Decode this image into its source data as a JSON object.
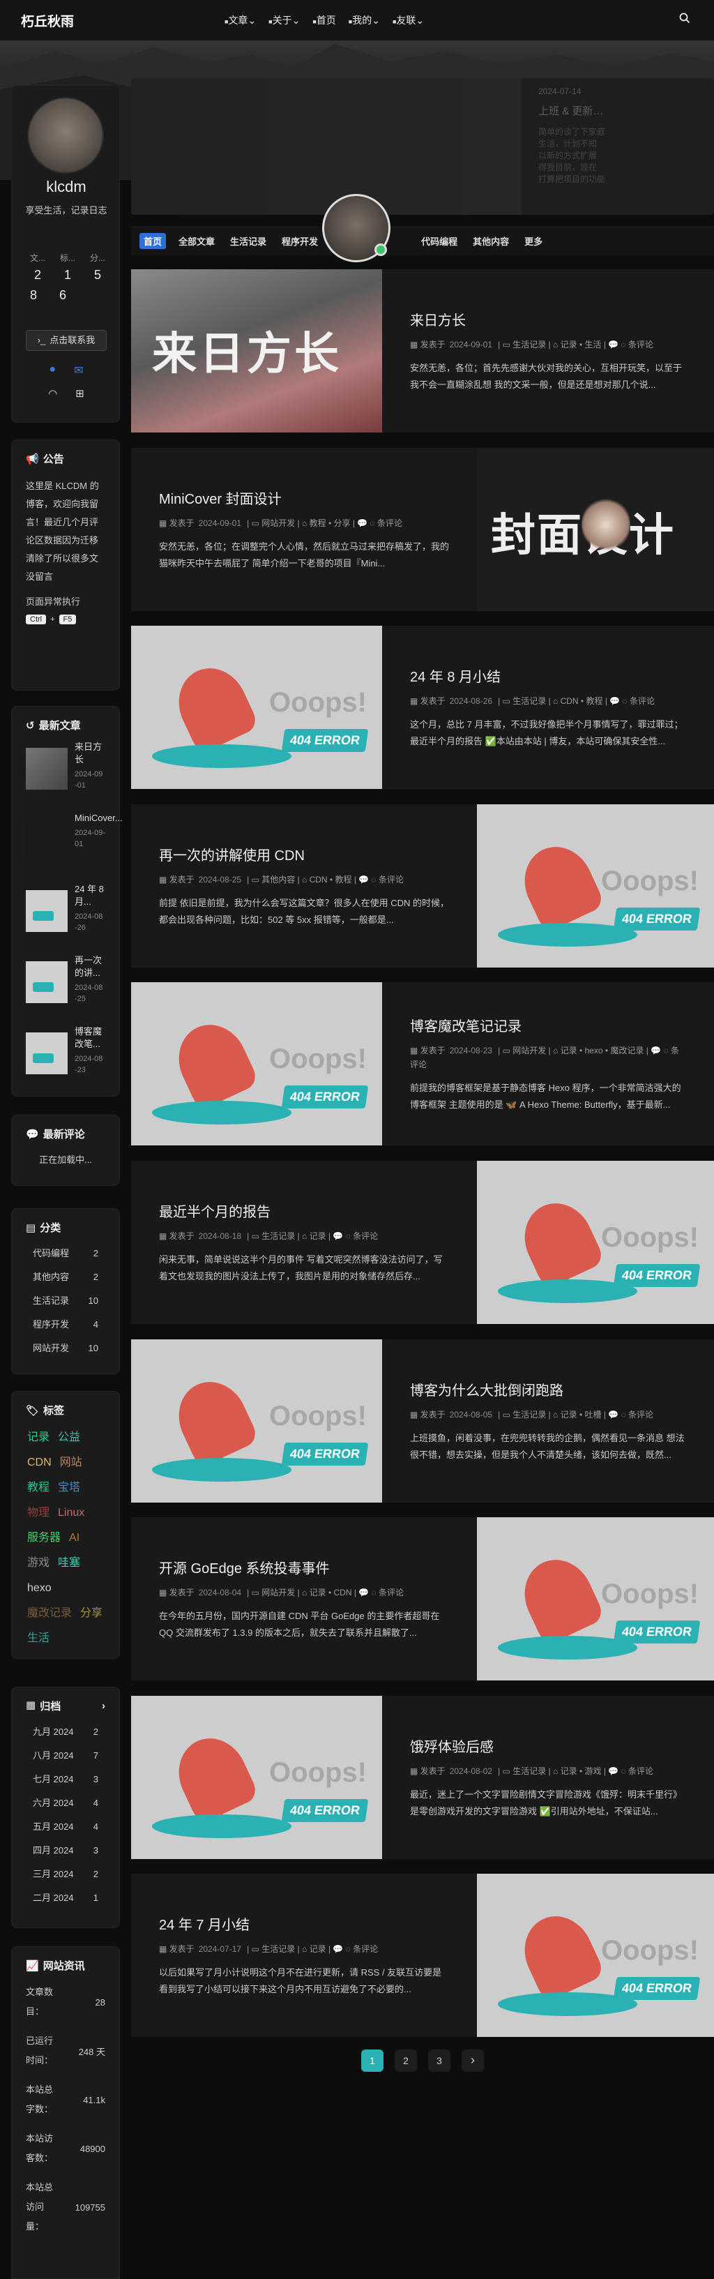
{
  "site": {
    "title": "朽丘秋雨"
  },
  "nav": {
    "items": [
      {
        "label": "文章",
        "icon": "folder-icon",
        "dropdown": true
      },
      {
        "label": "关于",
        "icon": "list-icon",
        "dropdown": true
      },
      {
        "label": "首页",
        "icon": "home-icon",
        "dropdown": false
      },
      {
        "label": "我的",
        "icon": "grid-icon",
        "dropdown": true
      },
      {
        "label": "友联",
        "icon": "link-icon",
        "dropdown": true
      }
    ],
    "search_icon": "search-icon"
  },
  "hero": {
    "date": "2024-07-14",
    "headline": "上班 & 更新…",
    "lines": [
      "简单的谈了下家庭",
      "生活，计划不知",
      "以新的方式扩展",
      "得我目前，现在",
      "打算把项目的功能"
    ]
  },
  "profile": {
    "name": "klcdm",
    "bio": "享受生活，记录日志",
    "stats": [
      {
        "label": "文...",
        "value": "2"
      },
      {
        "label": "标...",
        "value": "1"
      },
      {
        "label": "分...",
        "value": "5"
      },
      {
        "label": "",
        "value": "8"
      },
      {
        "label": "",
        "value": "6"
      }
    ],
    "button": "点击联系我"
  },
  "notice": {
    "title": "公告",
    "text": "这里是 KLCDM 的博客，欢迎向我留言！最近几个月评论区数据因为迁移清除了所以很多文没留言",
    "hint": "页面异常执行",
    "keys": [
      "Ctrl",
      "+",
      "F5"
    ]
  },
  "recent": {
    "title": "最新文章",
    "items": [
      {
        "title": "来日方长",
        "date": "2024-09-01"
      },
      {
        "title": "MiniCover...",
        "date": "2024-09-01"
      },
      {
        "title": "24 年 8 月...",
        "date": "2024-08-26"
      },
      {
        "title": "再一次的讲...",
        "date": "2024-08-25"
      },
      {
        "title": "博客魔改笔...",
        "date": "2024-08-23"
      }
    ]
  },
  "comments": {
    "title": "最新评论",
    "loading": "正在加载中..."
  },
  "categories": {
    "title": "分类",
    "items": [
      {
        "name": "代码编程",
        "count": "2"
      },
      {
        "name": "其他内容",
        "count": "2"
      },
      {
        "name": "生活记录",
        "count": "10"
      },
      {
        "name": "程序开发",
        "count": "4"
      },
      {
        "name": "网站开发",
        "count": "10"
      }
    ]
  },
  "tags": {
    "title": "标签",
    "items": [
      {
        "name": "记录",
        "color": "#27d18b"
      },
      {
        "name": "公益",
        "color": "#46b8a8"
      },
      {
        "name": "CDN",
        "color": "#e0b46a"
      },
      {
        "name": "网站",
        "color": "#b48a5a"
      },
      {
        "name": "教程",
        "color": "#2cc38f"
      },
      {
        "name": "宝塔",
        "color": "#3a8bd6"
      },
      {
        "name": "物理",
        "color": "#9b3b3b"
      },
      {
        "name": "Linux",
        "color": "#c46a6a"
      },
      {
        "name": "服务器",
        "color": "#3ecf6e"
      },
      {
        "name": "AI",
        "color": "#b07a2a"
      },
      {
        "name": "游戏",
        "color": "#8a8a8a"
      },
      {
        "name": "哇塞",
        "color": "#2fd6b0"
      },
      {
        "name": "hexo",
        "color": "#cfcfcf"
      },
      {
        "name": "魔改记录",
        "color": "#7a5b3a"
      },
      {
        "name": "分享",
        "color": "#a8923a"
      },
      {
        "name": "生活",
        "color": "#2aa398"
      }
    ]
  },
  "archives": {
    "title": "归档",
    "items": [
      {
        "month": "九月 2024",
        "count": "2"
      },
      {
        "month": "八月 2024",
        "count": "7"
      },
      {
        "month": "七月 2024",
        "count": "3"
      },
      {
        "month": "六月 2024",
        "count": "4"
      },
      {
        "month": "五月 2024",
        "count": "4"
      },
      {
        "month": "四月 2024",
        "count": "3"
      },
      {
        "month": "三月 2024",
        "count": "2"
      },
      {
        "month": "二月 2024",
        "count": "1"
      }
    ]
  },
  "site_stats": {
    "title": "网站资讯",
    "items": [
      {
        "label": "文章数目：",
        "value": "28"
      },
      {
        "label": "已运行时间：",
        "value": "248 天"
      },
      {
        "label": "本站总字数：",
        "value": "41.1k"
      },
      {
        "label": "本站访客数：",
        "value": "48900"
      },
      {
        "label": "本站总访问量：",
        "value": "109755"
      }
    ]
  },
  "category_bar": {
    "items": [
      "首页",
      "全部文章",
      "生活记录",
      "程序开发",
      "代码编程",
      "其他内容",
      "更多"
    ]
  },
  "posts": [
    {
      "title": "来日方长",
      "date": "2024-09-01",
      "category": "生活记录",
      "tags": [
        "记录",
        "生活"
      ],
      "comments": "条评论",
      "excerpt": "安然无恙，各位；首先先感谢大伙对我的关心，互相开玩笑，以至于我不会一直糊涂乱想 我的文采一般，但是还是想对那几个说...",
      "cover": "cat",
      "cover_text": "来日方长"
    },
    {
      "title": "MiniCover 封面设计",
      "date": "2024-09-01",
      "category": "网站开发",
      "tags": [
        "教程",
        "分享"
      ],
      "comments": "条评论",
      "excerpt": "安然无恙，各位；在调整完个人心情，然后就立马过来把存稿发了，我的猫咪昨天中午去嗝屁了 简单介绍一下老哥的项目『Mini...",
      "cover": "minicover",
      "cover_text": "封面设计"
    },
    {
      "title": "24 年 8 月小结",
      "date": "2024-08-26",
      "category": "生活记录",
      "tags": [
        "CDN",
        "教程"
      ],
      "comments": "条评论",
      "excerpt": "这个月，总比 7 月丰富，不过我好像把半个月事情写了，罪过罪过；最近半个月的报告 ✅本站由本站 | 博友，本站可确保其安全性...",
      "cover": "404",
      "cover_text": "Ooops!"
    },
    {
      "title": "再一次的讲解使用 CDN",
      "date": "2024-08-25",
      "category": "其他内容",
      "tags": [
        "CDN",
        "教程"
      ],
      "comments": "条评论",
      "excerpt": "前提 依旧是前提，我为什么会写这篇文章？很多人在使用 CDN 的时候，都会出现各种问题，比如：502 等 5xx 报错等，一般都是...",
      "cover": "404",
      "cover_text": "Ooops!"
    },
    {
      "title": "博客魔改笔记记录",
      "date": "2024-08-23",
      "category": "网站开发",
      "tags": [
        "记录",
        "hexo",
        "魔改记录"
      ],
      "comments": "条评论",
      "excerpt": "前提我的博客框架是基于静态博客 Hexo 程序，一个非常简洁强大的博客框架 主题使用的是 🦋 A Hexo Theme: Butterfly，基于最新...",
      "cover": "404",
      "cover_text": "Ooops!"
    },
    {
      "title": "最近半个月的报告",
      "date": "2024-08-18",
      "category": "生活记录",
      "tags": [
        "记录"
      ],
      "comments": "条评论",
      "excerpt": "闲来无事，简单说说这半个月的事件 写着文呢突然博客没法访问了，写着文也发现我的图片没法上传了，我图片是用的对象储存然后存...",
      "cover": "404",
      "cover_text": "Ooops!"
    },
    {
      "title": "博客为什么大批倒闭跑路",
      "date": "2024-08-05",
      "category": "生活记录",
      "tags": [
        "记录",
        "吐槽"
      ],
      "comments": "条评论",
      "excerpt": "上班摸鱼，闲着没事，在兜兜转转我的企鹅，偶然看见一条消息 想法很不错，想去实操，但是我个人不清楚头绪，该如何去做，既然...",
      "cover": "404",
      "cover_text": "Ooops!"
    },
    {
      "title": "开源 GoEdge 系统投毒事件",
      "date": "2024-08-04",
      "category": "网站开发",
      "tags": [
        "记录",
        "CDN"
      ],
      "comments": "条评论",
      "excerpt": "在今年的五月份，国内开源自建 CDN 平台 GoEdge 的主要作者超哥在 QQ 交流群发布了 1.3.9 的版本之后，就失去了联系并且解散了...",
      "cover": "404",
      "cover_text": "Ooops!"
    },
    {
      "title": "饿殍体验后感",
      "date": "2024-08-02",
      "category": "生活记录",
      "tags": [
        "记录",
        "游戏"
      ],
      "comments": "条评论",
      "excerpt": "最近，迷上了一个文字冒险剧情文字冒险游戏《饿殍：明末千里行》是零创游戏开发的文字冒险游戏 ✅引用站外地址，不保证站...",
      "cover": "404",
      "cover_text": "Ooops!"
    },
    {
      "title": "24 年 7 月小结",
      "date": "2024-07-17",
      "category": "生活记录",
      "tags": [
        "记录"
      ],
      "comments": "条评论",
      "excerpt": "以后如果写了月小计说明这个月不在进行更新，请 RSS / 友联互访要是看到我写了小结可以接下来这个月内不用互访避免了不必要的...",
      "cover": "404",
      "cover_text": "Ooops!"
    }
  ],
  "pager": {
    "pages": [
      "1",
      "2",
      "3"
    ],
    "next": "›"
  },
  "meta_prefix": "发表于",
  "error_badge": "404 ERROR"
}
